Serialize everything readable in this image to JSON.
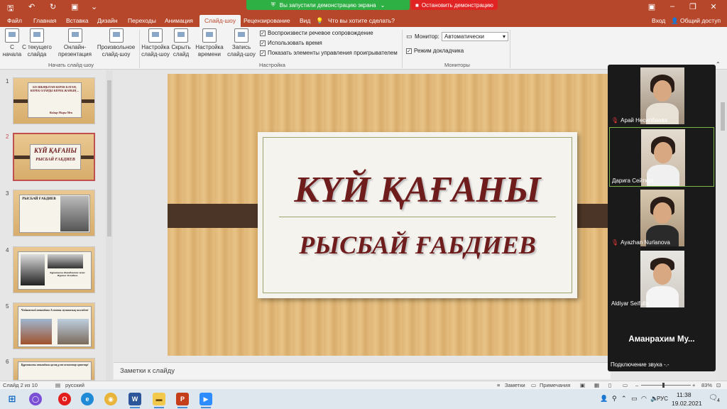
{
  "titlebar": {
    "share_banner": "Вы запустили демонстрацию экрана",
    "stop_share": "Остановить демонстрацию"
  },
  "tabs": [
    "Файл",
    "Главная",
    "Вставка",
    "Дизайн",
    "Переходы",
    "Анимация",
    "Слайд-шоу",
    "Рецензирование",
    "Вид"
  ],
  "active_tab": "Слайд-шоу",
  "tell_me": "Что вы хотите сделать?",
  "account": {
    "signin": "Вход",
    "share": "Общий доступ"
  },
  "ribbon": {
    "start": {
      "from_beginning": "С начала",
      "from_current": "С текущего слайда",
      "online": "Онлайн-презентация",
      "custom": "Произвольное слайд-шоу",
      "group": "Начать слайд-шоу"
    },
    "setup": {
      "setup_show": "Настройка слайд-шоу",
      "hide_slide": "Скрыть слайд",
      "rehearse": "Настройка времени",
      "record": "Запись слайд-шоу",
      "play_narration": "Воспроизвести речевое сопровождение",
      "use_timings": "Использовать время",
      "show_controls": "Показать элементы управления проигрывателем",
      "group": "Настройка"
    },
    "monitors": {
      "monitor_label": "Монитор:",
      "monitor_value": "Автоматически",
      "presenter_view": "Режим докладчика",
      "group": "Мониторы"
    }
  },
  "thumbnails": [
    {
      "num": "1",
      "text": "БІЗ ШЫҢЫТАН КЕРЕК КАТАН, КЕРЕК ОЛАРДЫ КЕРЕК ЖАНЫҢ ...",
      "sig": "Кайыр Мыры Мен"
    },
    {
      "num": "2",
      "title": "КҮЙ ҚАҒАНЫ",
      "sub": "РЫСБАЙ ҒАБДИЕВ"
    },
    {
      "num": "3",
      "title": "РЫСБАЙ ҒАБДИЕВ"
    },
    {
      "num": "4",
      "caption": "Құрманғазы Жиенбаевпен және Нұрғиса Тілендиев"
    },
    {
      "num": "5",
      "title": "Чайковский атындағы Алматы музыкалық колледжі"
    },
    {
      "num": "6",
      "title": "Құрманғазы атындағы қазақ ұлт-аспаптар оркестрі"
    }
  ],
  "slide": {
    "title": "КҮЙ ҚАҒАНЫ",
    "subtitle": "РЫСБАЙ ҒАБДИЕВ"
  },
  "notes_label": "Заметки к слайду",
  "zoom_participants": [
    {
      "name": "Арай Несипбаева",
      "muted": true
    },
    {
      "name": "Дарига Сейтқұл",
      "muted": false,
      "active": true
    },
    {
      "name": "Ayazhan Nurlanova",
      "muted": true
    },
    {
      "name": "Aldiyar Seifulla",
      "muted": false
    }
  ],
  "zoom_extra_name": "Аманрахим Му...",
  "zoom_audio_status": "Подключение звука -.-",
  "statusbar": {
    "slide_info": "Слайд 2 из 10",
    "language": "русский",
    "notes": "Заметки",
    "comments": "Примечания",
    "zoom": "83%"
  },
  "taskbar": {
    "time": "11:38",
    "date": "19.02.2021",
    "lang": "РУС",
    "notif_count": "4"
  }
}
